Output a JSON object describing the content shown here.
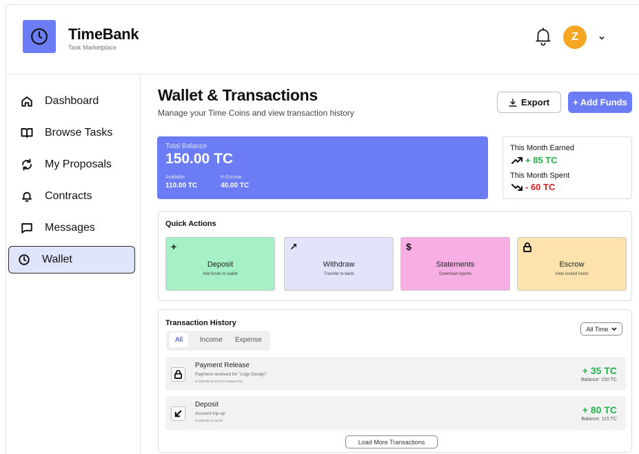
{
  "header": {
    "brand_name": "TimeBank",
    "brand_sub": "Task Marketplace",
    "avatar_initial": "Z",
    "icons": [
      "clock-icon",
      "bell-icon",
      "chevron-down-icon"
    ]
  },
  "sidebar": {
    "items": [
      {
        "label": "Dashboard",
        "icon": "home-icon"
      },
      {
        "label": "Browse Tasks",
        "icon": "book-icon"
      },
      {
        "label": "My Proposals",
        "icon": "refresh-icon"
      },
      {
        "label": "Contracts",
        "icon": "bell-icon"
      },
      {
        "label": "Messages",
        "icon": "chat-icon"
      },
      {
        "label": "Wallet",
        "icon": "clock-icon",
        "active": true
      }
    ]
  },
  "main": {
    "title": "Wallet & Transactions",
    "subtitle": "Manage your Time Coins and view transaction history",
    "export_label": "Export",
    "add_funds_label": "+ Add Funds"
  },
  "balance": {
    "total_label": "Total Balance",
    "total_value": "150.00 TC",
    "available_label": "Available",
    "available_value": "110.00 TC",
    "escrow_label": "In Escrow",
    "escrow_value": "40.00 TC"
  },
  "month": {
    "earned_label": "This Month Earned",
    "earned_value": "+ 85 TC",
    "spent_label": "This Month Spent",
    "spent_value": "- 60 TC"
  },
  "quick_actions": {
    "title": "Quick Actions",
    "cards": [
      {
        "icon": "+",
        "title": "Deposit",
        "sub": "Add funds to wallet",
        "color": "#a6f0c6"
      },
      {
        "icon": "↗",
        "title": "Withdraw",
        "sub": "Transfer to bank",
        "color": "#e2e4fa"
      },
      {
        "icon": "$",
        "title": "Statements",
        "sub": "Download reports",
        "color": "#f7aee3"
      },
      {
        "icon": "lock",
        "title": "Escrow",
        "sub": "View locked funds",
        "color": "#fce3ad"
      }
    ]
  },
  "history": {
    "title": "Transaction History",
    "tabs": [
      "All",
      "Income",
      "Expense"
    ],
    "filter_value": "All Time",
    "rows": [
      {
        "title": "Payment Release",
        "desc": "Payment received for \"Logo Design\"",
        "meta": "● 2025-05-26  13:02  |  Contract #14",
        "amount": "+ 35 TC",
        "balance": "Balance: 150 TC",
        "icon": "lock-icon"
      },
      {
        "title": "Deposit",
        "desc": "Account top-up",
        "meta": "● 2025-05-24  16:46",
        "amount": "+ 80 TC",
        "balance": "Balance: 115 TC",
        "icon": "arrow-down-left-icon"
      }
    ],
    "load_more_label": "Load More Transactions"
  },
  "colors": {
    "accent": "#6b7cf5",
    "positive": "#22b14c",
    "negative": "#d91f1f",
    "avatar": "#f5a623"
  }
}
